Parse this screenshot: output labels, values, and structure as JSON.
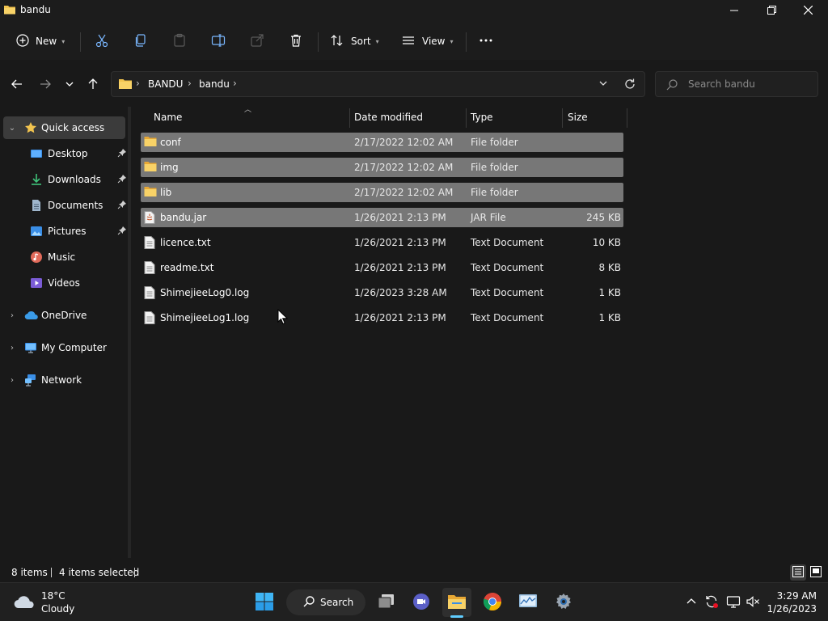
{
  "window": {
    "title": "bandu",
    "minimize": "minimize",
    "maximize": "restore",
    "close": "close"
  },
  "commandbar": {
    "new_label": "New",
    "sort_label": "Sort",
    "view_label": "View"
  },
  "address": {
    "crumbs": [
      "BANDU",
      "bandu"
    ]
  },
  "search": {
    "placeholder": "Search bandu"
  },
  "navpane": {
    "quick_access": "Quick access",
    "items": [
      {
        "label": "Desktop",
        "icon": "desktop-icon",
        "pinned": true
      },
      {
        "label": "Downloads",
        "icon": "downloads-icon",
        "pinned": true
      },
      {
        "label": "Documents",
        "icon": "documents-icon",
        "pinned": true
      },
      {
        "label": "Pictures",
        "icon": "pictures-icon",
        "pinned": true
      },
      {
        "label": "Music",
        "icon": "music-icon",
        "pinned": false
      },
      {
        "label": "Videos",
        "icon": "videos-icon",
        "pinned": false
      }
    ],
    "onedrive": "OneDrive",
    "my_computer": "My Computer",
    "network": "Network"
  },
  "columns": {
    "name": "Name",
    "date": "Date modified",
    "type": "Type",
    "size": "Size"
  },
  "files": [
    {
      "name": "conf",
      "date": "2/17/2022 12:02 AM",
      "type": "File folder",
      "size": "",
      "kind": "folder",
      "selected": true
    },
    {
      "name": "img",
      "date": "2/17/2022 12:02 AM",
      "type": "File folder",
      "size": "",
      "kind": "folder",
      "selected": true
    },
    {
      "name": "lib",
      "date": "2/17/2022 12:02 AM",
      "type": "File folder",
      "size": "",
      "kind": "folder",
      "selected": true
    },
    {
      "name": "bandu.jar",
      "date": "1/26/2021 2:13 PM",
      "type": "JAR File",
      "size": "245 KB",
      "kind": "jar",
      "selected": true
    },
    {
      "name": "licence.txt",
      "date": "1/26/2021 2:13 PM",
      "type": "Text Document",
      "size": "10 KB",
      "kind": "text",
      "selected": false
    },
    {
      "name": "readme.txt",
      "date": "1/26/2021 2:13 PM",
      "type": "Text Document",
      "size": "8 KB",
      "kind": "text",
      "selected": false
    },
    {
      "name": "ShimejieeLog0.log",
      "date": "1/26/2023 3:28 AM",
      "type": "Text Document",
      "size": "1 KB",
      "kind": "text",
      "selected": false
    },
    {
      "name": "ShimejieeLog1.log",
      "date": "1/26/2021 2:13 PM",
      "type": "Text Document",
      "size": "1 KB",
      "kind": "text",
      "selected": false
    }
  ],
  "status": {
    "item_count": "8 items",
    "selected_count": "4 items selected"
  },
  "taskbar": {
    "weather_temp": "18°C",
    "weather_cond": "Cloudy",
    "search_label": "Search",
    "time": "3:29 AM",
    "date": "1/26/2023"
  },
  "colors": {
    "accent": "#60cdff",
    "folder": "#f2c44f",
    "selection": "#777777"
  }
}
